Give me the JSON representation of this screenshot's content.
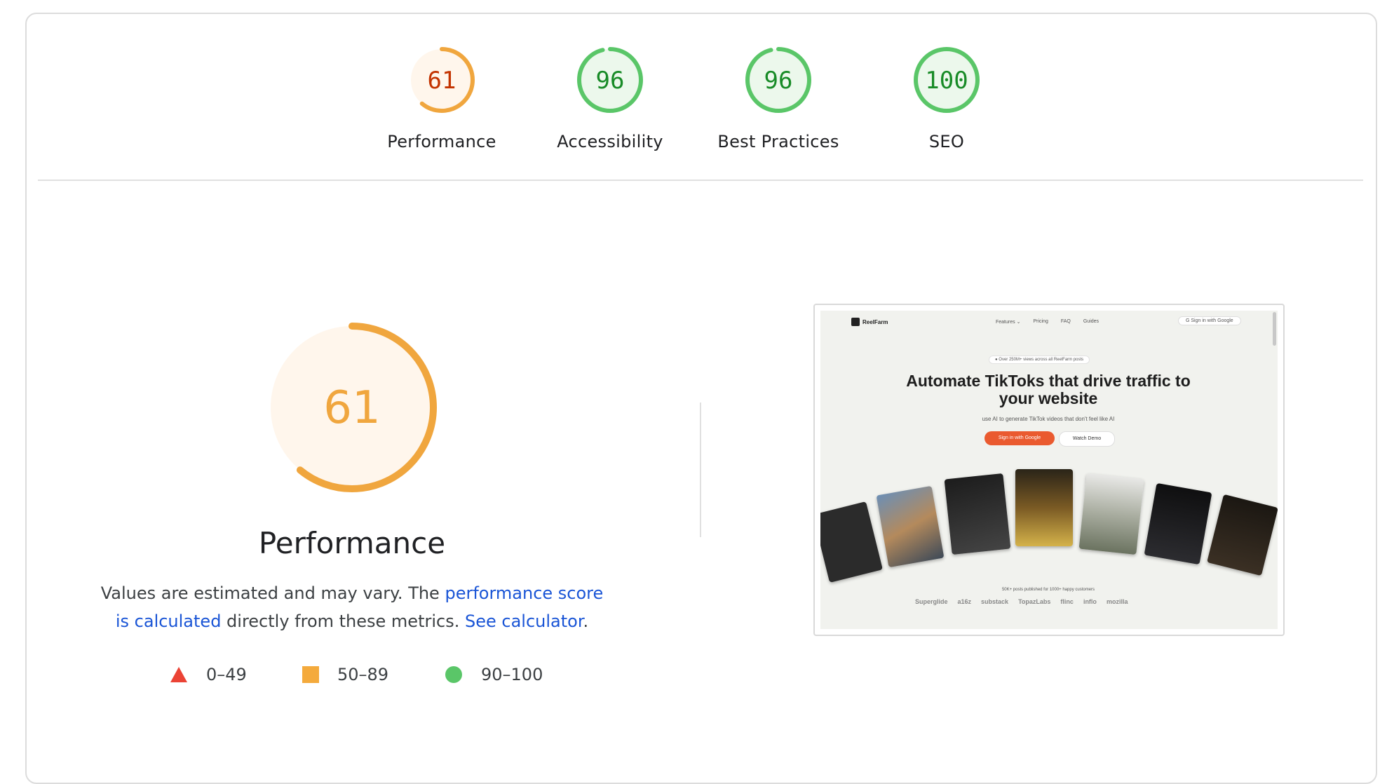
{
  "categories": [
    {
      "label": "Performance",
      "score": 61,
      "status": "average"
    },
    {
      "label": "Accessibility",
      "score": 96,
      "status": "pass"
    },
    {
      "label": "Best Practices",
      "score": 96,
      "status": "pass"
    },
    {
      "label": "SEO",
      "score": 100,
      "status": "pass"
    }
  ],
  "main": {
    "score": "61",
    "title": "Performance",
    "desc_1": "Values are estimated and may vary. The ",
    "link_score": "performance score is calculated",
    "desc_2": " directly from these metrics. ",
    "link_calc": "See calculator",
    "desc_3": "."
  },
  "legend": [
    {
      "range": "0–49",
      "shape": "triangle",
      "color": "#eb4335"
    },
    {
      "range": "50–89",
      "shape": "square",
      "color": "#f4aa3c"
    },
    {
      "range": "90–100",
      "shape": "circle",
      "color": "#5ac668"
    }
  ],
  "colors": {
    "fail": "#eb4335",
    "average": "#f0a63e",
    "average_text": "#c33300",
    "average_bg": "#fff6ec",
    "pass": "#5ac668",
    "pass_text": "#188b27",
    "pass_bg": "#ecf8ec"
  },
  "screenshot": {
    "logo": "ReelFarm",
    "nav": [
      "Features ⌄",
      "Pricing",
      "FAQ",
      "Guides"
    ],
    "signin": "G  Sign in with Google",
    "badge": "● Over 250M+ views across all ReelFarm posts",
    "headline": "Automate TikToks that drive traffic to your website",
    "sub": "use AI to generate TikTok videos that don't feel like AI",
    "cta_primary": "Sign in with Google",
    "cta_secondary": "Watch Demo",
    "tagline": "50K+ posts published for 1000+ happy customers",
    "brands": [
      "Superglide",
      "a16z",
      "substack",
      "TopazLabs",
      "flinc",
      "inflo",
      "mozilla"
    ]
  }
}
